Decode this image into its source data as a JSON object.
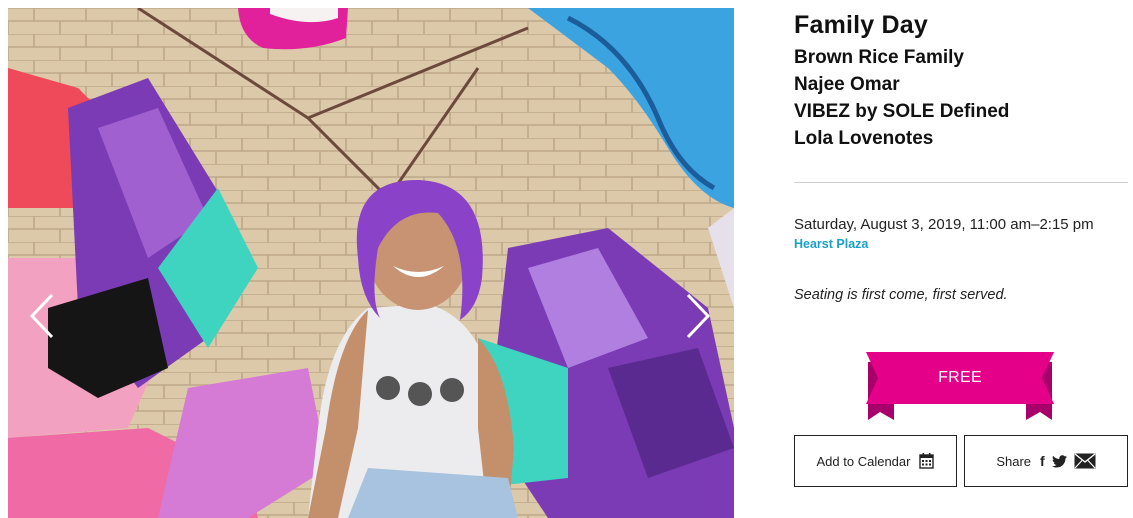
{
  "carousel": {
    "image_alt": "Young woman with purple hair smiling in front of a mural",
    "prev_icon": "chevron-left-icon",
    "next_icon": "chevron-right-icon"
  },
  "event": {
    "title": "Family Day",
    "performers": [
      "Brown Rice Family",
      "Najee Omar",
      "VIBEZ by SOLE Defined",
      "Lola Lovenotes"
    ],
    "datetime": "Saturday, August 3, 2019, 11:00 am–2:15 pm",
    "venue": "Hearst Plaza",
    "seating_note": "Seating is first come, first served."
  },
  "price": {
    "label": "FREE"
  },
  "actions": {
    "add_to_calendar": "Add to Calendar",
    "share": "Share",
    "calendar_icon": "calendar-icon",
    "share_icons": [
      "facebook-icon",
      "twitter-icon",
      "email-icon"
    ]
  },
  "colors": {
    "accent_magenta": "#e5008a",
    "banner_fold": "#a8006a",
    "link_blue": "#1aa0c7",
    "divider": "#cfcfcf",
    "text": "#111111"
  }
}
